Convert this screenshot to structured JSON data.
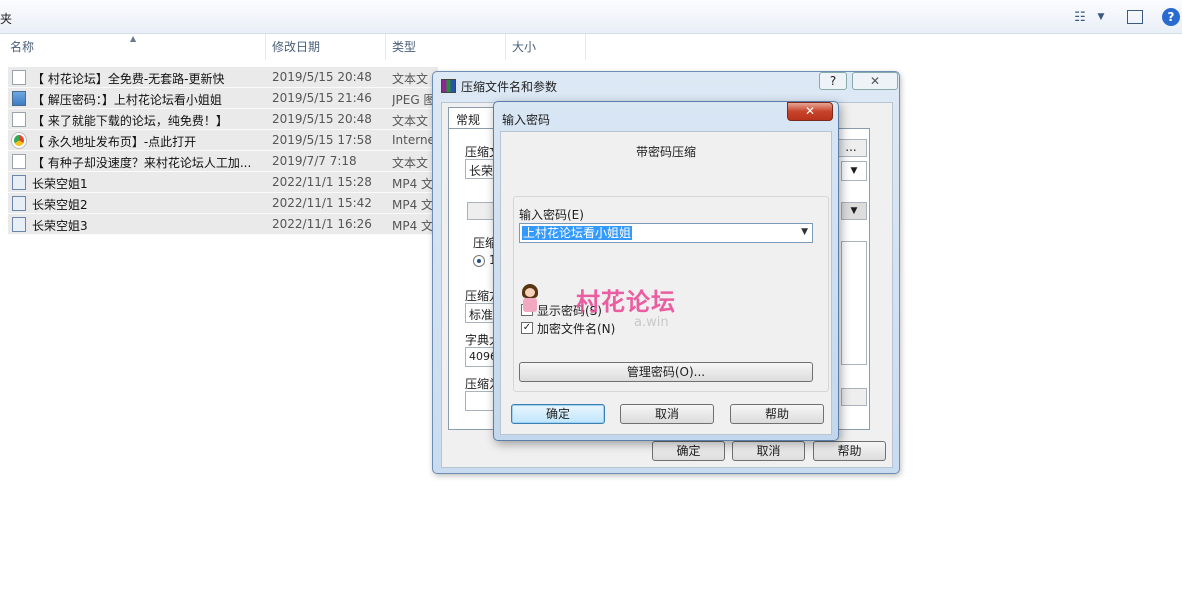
{
  "explorer": {
    "title_fragment": "夹",
    "columns": [
      "名称",
      "修改日期",
      "类型",
      "大小"
    ],
    "files": [
      {
        "icon": "text-file-icon",
        "name": "【 村花论坛】全免费-无套路-更新快",
        "date": "2019/5/15 20:48",
        "type": "文本文"
      },
      {
        "icon": "image-file-icon",
        "name": "【 解压密码：】上村花论坛看小姐姐",
        "date": "2019/5/15 21:46",
        "type": "JPEG 图"
      },
      {
        "icon": "text-file-icon",
        "name": "【 来了就能下载的论坛，纯免费！】",
        "date": "2019/5/15 20:48",
        "type": "文本文"
      },
      {
        "icon": "browser-shortcut-icon",
        "name": "【 永久地址发布页】-点此打开",
        "date": "2019/5/15 17:58",
        "type": "Interne"
      },
      {
        "icon": "text-file-icon",
        "name": "【 有种子却没速度？来村花论坛人工加...",
        "date": "2019/7/7 7:18",
        "type": "文本文"
      },
      {
        "icon": "video-file-icon",
        "name": "长荣空姐1",
        "date": "2022/11/1 15:28",
        "type": "MP4 文"
      },
      {
        "icon": "video-file-icon",
        "name": "长荣空姐2",
        "date": "2022/11/1 15:42",
        "type": "MP4 文"
      },
      {
        "icon": "video-file-icon",
        "name": "长荣空姐3",
        "date": "2022/11/1 16:26",
        "type": "MP4 文"
      }
    ]
  },
  "archive_dialog": {
    "title": "压缩文件名和参数",
    "help": "?",
    "close": "✕",
    "tab_general": "常规",
    "frag_archive_name": "压缩文",
    "frag_name_value": "长荣",
    "frag_compress_method_group": "压缩",
    "frag_radio": "1",
    "frag_compress_level": "压缩方",
    "frag_level_value": "标准",
    "frag_dict": "字典大",
    "frag_dict_value": "4096",
    "frag_split": "压缩为",
    "browse_frag": "...",
    "ok": "确定",
    "cancel": "取消",
    "help_btn": "帮助"
  },
  "password_dialog": {
    "title": "输入密码",
    "close": "✕",
    "heading": "带密码压缩",
    "field_label": "输入密码(E)",
    "password_value": "上村花论坛看小姐姐",
    "show_password": "显示密码(S)",
    "show_password_checked": false,
    "encrypt_names": "加密文件名(N)",
    "encrypt_names_checked": true,
    "manage": "管理密码(O)...",
    "ok": "确定",
    "cancel": "取消",
    "help": "帮助"
  },
  "watermark": {
    "text": "村花论坛",
    "sub": "a.win"
  }
}
